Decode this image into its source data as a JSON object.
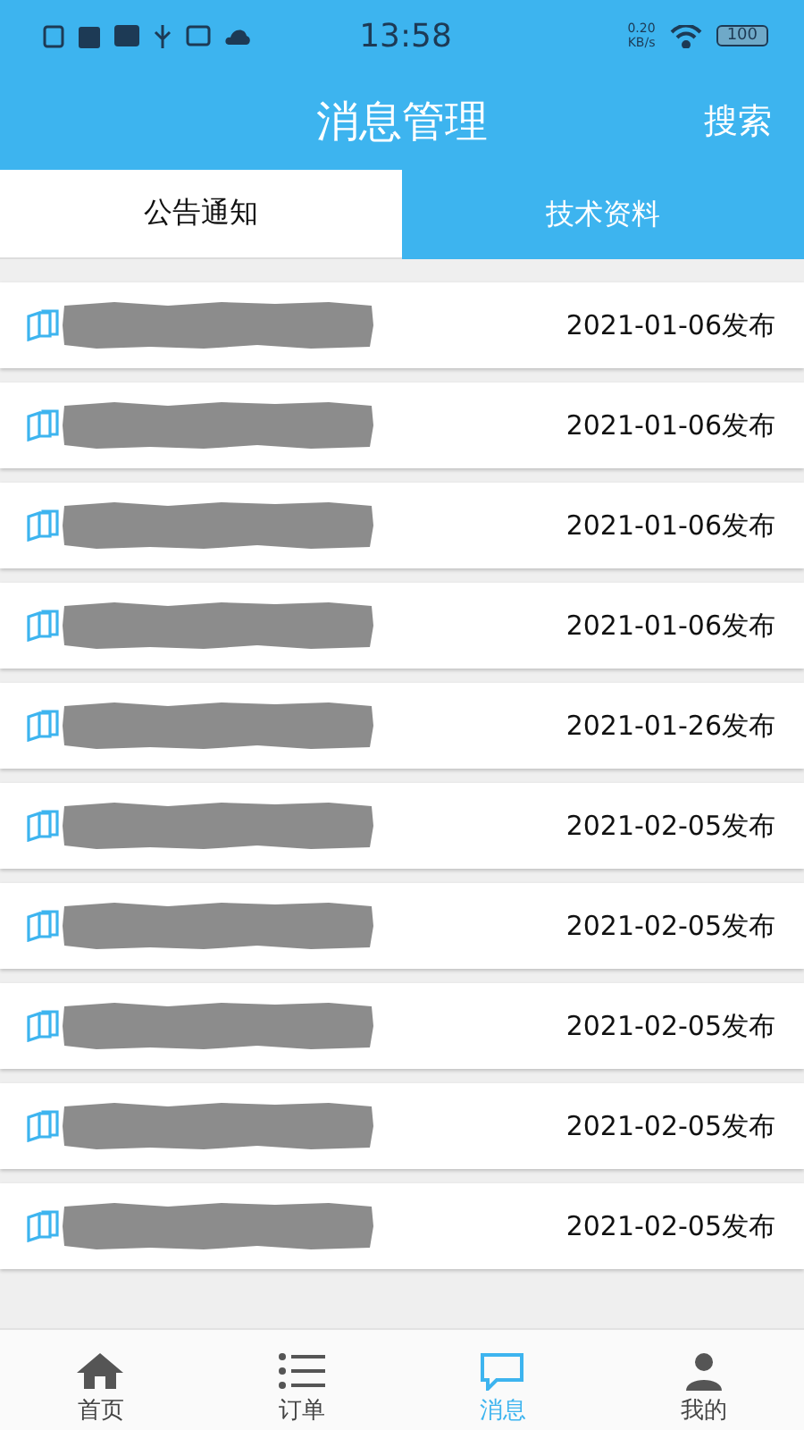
{
  "status_bar": {
    "time": "13:58",
    "speed_value": "0.20",
    "speed_unit": "KB/s",
    "battery": "100"
  },
  "header": {
    "title": "消息管理",
    "action": "搜索"
  },
  "tabs": [
    {
      "label": "公告通知",
      "selected": false
    },
    {
      "label": "技术资料",
      "selected": true
    }
  ],
  "items": [
    {
      "date": "2021-01-06发布"
    },
    {
      "date": "2021-01-06发布"
    },
    {
      "date": "2021-01-06发布"
    },
    {
      "date": "2021-01-06发布"
    },
    {
      "date": "2021-01-26发布"
    },
    {
      "date": "2021-02-05发布"
    },
    {
      "date": "2021-02-05发布"
    },
    {
      "date": "2021-02-05发布"
    },
    {
      "date": "2021-02-05发布"
    },
    {
      "date": "2021-02-05发布"
    }
  ],
  "bottom_nav": [
    {
      "kind": "home",
      "label": "首页",
      "selected": false
    },
    {
      "kind": "list",
      "label": "订单",
      "selected": false
    },
    {
      "kind": "message",
      "label": "消息",
      "selected": true
    },
    {
      "kind": "user",
      "label": "我的",
      "selected": false
    }
  ]
}
